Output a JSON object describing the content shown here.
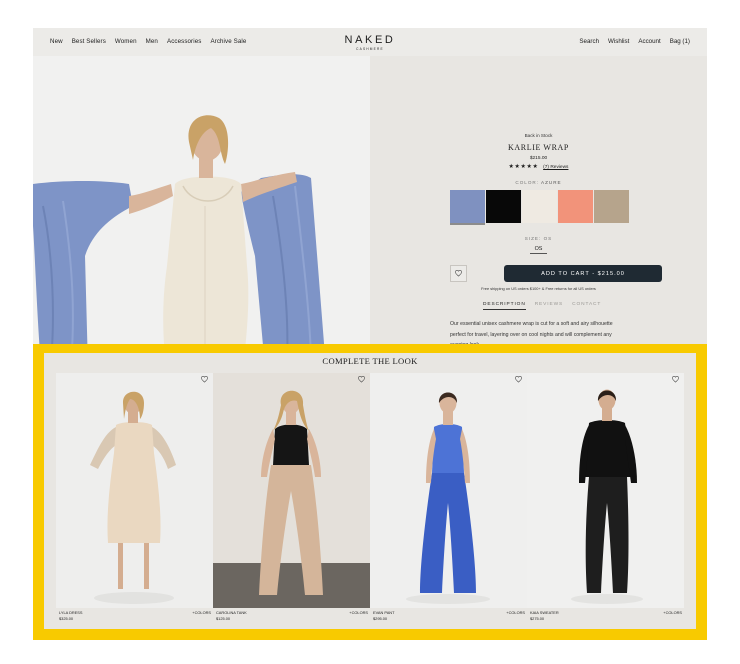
{
  "nav": {
    "left": [
      "New",
      "Best Sellers",
      "Women",
      "Men",
      "Accessories",
      "Archive Sale"
    ],
    "right": [
      "Search",
      "Wishlist",
      "Account",
      "Bag (1)"
    ]
  },
  "logo": {
    "main": "NAKED",
    "sub": "CASHMERE"
  },
  "product": {
    "stock": "Back in Stock",
    "title": "KARLIE WRAP",
    "price": "$215.00",
    "stars": "★★★★★",
    "rating": 5,
    "reviews": "(7) Reviews",
    "color_label": "COLOR:",
    "color_value": "AZURE",
    "swatches": [
      {
        "name": "azure",
        "color": "#7f91c0",
        "selected": true
      },
      {
        "name": "black",
        "color": "#080808",
        "selected": false
      },
      {
        "name": "cream",
        "color": "#efeae2",
        "selected": false
      },
      {
        "name": "coral",
        "color": "#f2937a",
        "selected": false
      },
      {
        "name": "taupe",
        "color": "#b6a48c",
        "selected": false
      }
    ],
    "size_label": "SIZE:",
    "size_value": "OS",
    "size_option": "OS",
    "cart_label": "ADD TO CART - $215.00",
    "shipping": "Free shipping on US orders $100+ & Free returns for all US orders",
    "tabs": [
      "DESCRIPTION",
      "REVIEWS",
      "CONTACT"
    ],
    "description": "Our essential unisex cashmere wrap is cut for a soft and airy silhouette perfect for travel, layering over on cool nights and will complement any evening look."
  },
  "complete_look": {
    "title": "COMPLETE THE LOOK",
    "items": [
      {
        "name": "Lyla Dress",
        "price": "$325.00",
        "colors": "+COLORS"
      },
      {
        "name": "Carolina Tank",
        "price": "$125.00",
        "colors": "+COLORS"
      },
      {
        "name": "Evan Pant",
        "price": "$295.00",
        "colors": "+COLORS"
      },
      {
        "name": "Kaia Sweater",
        "price": "$275.00",
        "colors": "+COLORS"
      }
    ]
  },
  "colors": {
    "highlight": "#f8ca00",
    "cart_button": "#1f2a33",
    "page_bg": "#e8e6e2"
  }
}
